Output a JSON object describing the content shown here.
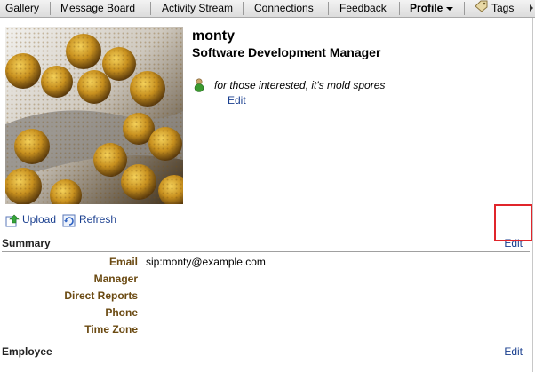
{
  "nav": {
    "tabs": [
      {
        "label": "Gallery"
      },
      {
        "label": "Message Board"
      },
      {
        "label": "Activity Stream"
      },
      {
        "label": "Connections"
      },
      {
        "label": "Feedback"
      },
      {
        "label": "Profile",
        "active": true
      },
      {
        "label": "Tags"
      }
    ]
  },
  "profile": {
    "name": "monty",
    "job_title": "Software Development Manager",
    "status": "for those interested, it's mold spores",
    "status_edit": "Edit",
    "photo_alt": "mold spores"
  },
  "photo_actions": {
    "upload": "Upload",
    "refresh": "Refresh"
  },
  "summary": {
    "title": "Summary",
    "edit": "Edit",
    "fields": [
      {
        "label": "Email",
        "value": "sip:monty@example.com"
      },
      {
        "label": "Manager",
        "value": ""
      },
      {
        "label": "Direct Reports",
        "value": ""
      },
      {
        "label": "Phone",
        "value": ""
      },
      {
        "label": "Time Zone",
        "value": ""
      }
    ]
  },
  "employee": {
    "title": "Employee",
    "edit": "Edit"
  },
  "colors": {
    "link": "#1a3f8f",
    "label": "#6b4a12",
    "highlight": "#e0252b"
  }
}
